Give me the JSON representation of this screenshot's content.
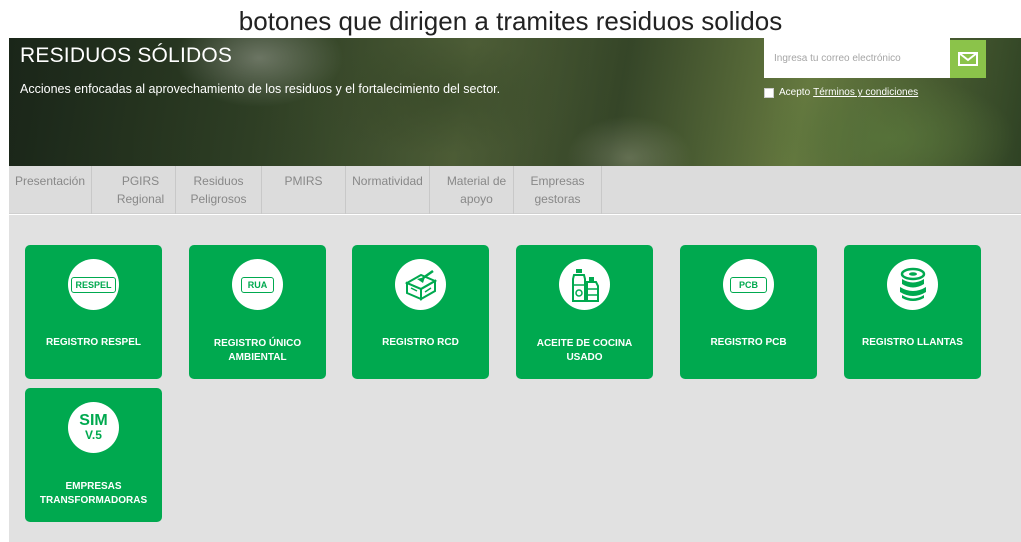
{
  "caption": "botones que dirigen a tramites residuos solidos",
  "hero": {
    "title": "RESIDUOS SÓLIDOS",
    "description": "Acciones enfocadas al aprovechamiento de los residuos y el fortalecimiento del sector."
  },
  "subscribe": {
    "placeholder": "Ingresa tu correo electrónico",
    "button_icon": "envelope-icon",
    "terms_prefix": "Acepto",
    "terms_link": "Términos y condiciones"
  },
  "tabs": [
    {
      "label": "Presentación"
    },
    {
      "label": "PGIRS Regional"
    },
    {
      "label": "Residuos Peligrosos"
    },
    {
      "label": "PMIRS"
    },
    {
      "label": "Normatividad"
    },
    {
      "label": "Material de apoyo"
    },
    {
      "label": "Empresas gestoras"
    }
  ],
  "cards": [
    {
      "label": "REGISTRO RESPEL",
      "icon": "respel-badge-icon",
      "icon_text": "RESPEL"
    },
    {
      "label": "REGISTRO ÚNICO AMBIENTAL",
      "icon": "rua-badge-icon",
      "icon_text": "RUA"
    },
    {
      "label": "REGISTRO RCD",
      "icon": "construction-debris-icon"
    },
    {
      "label": "ACEITE DE COCINA USADO",
      "icon": "oil-bottles-icon"
    },
    {
      "label": "REGISTRO PCB",
      "icon": "pcb-badge-icon",
      "icon_text": "PCB"
    },
    {
      "label": "REGISTRO LLANTAS",
      "icon": "tires-stack-icon"
    },
    {
      "label": "EMPRESAS TRANSFORMADORAS",
      "icon": "sim-icon",
      "icon_text_1": "SIM",
      "icon_text_2": "V.5"
    }
  ],
  "colors": {
    "brand_green": "#00a94f",
    "subscribe_button": "#8bc34a",
    "tab_bar": "#dcdcdc",
    "content_bg": "#e1e1e1"
  }
}
